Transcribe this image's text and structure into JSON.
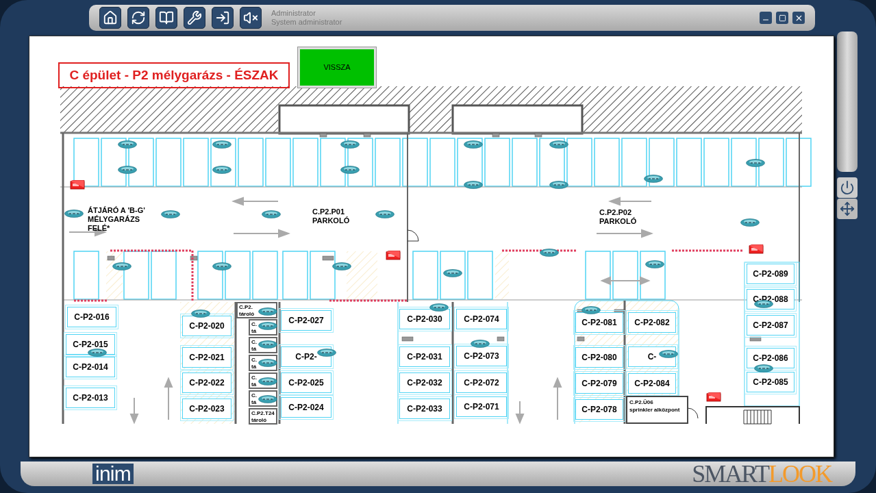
{
  "user": {
    "name": "Administrator",
    "role": "System administrator"
  },
  "map": {
    "title": "C épület - P2 mélygarázs - ÉSZAK",
    "back_button": "VISSZA",
    "areas": [
      {
        "lines": [
          "ÁTJÁRÓ A 'B-G'",
          "MÉLYGARÁZS",
          "FELÉ*"
        ]
      },
      {
        "lines": [
          "C.P2.P01",
          "PARKOLÓ"
        ]
      },
      {
        "lines": [
          "C.P2.P02",
          "PARKOLÓ"
        ]
      }
    ],
    "parking_spaces": [
      {
        "label": "C-P2-016"
      },
      {
        "label": "C-P2-015"
      },
      {
        "label": "C-P2-014"
      },
      {
        "label": "C-P2-013"
      },
      {
        "label": "C-P2-020"
      },
      {
        "label": "C-P2-021"
      },
      {
        "label": "C-P2-022"
      },
      {
        "label": "C-P2-023"
      },
      {
        "label": "C-P2-027"
      },
      {
        "label": "C-P2-"
      },
      {
        "label": "C-P2-025"
      },
      {
        "label": "C-P2-024"
      },
      {
        "label": "C-P2-030"
      },
      {
        "label": "C-P2-031"
      },
      {
        "label": "C-P2-032"
      },
      {
        "label": "C-P2-033"
      },
      {
        "label": "C-P2-074"
      },
      {
        "label": "C-P2-073"
      },
      {
        "label": "C-P2-072"
      },
      {
        "label": "C-P2-071"
      },
      {
        "label": "C-P2-081"
      },
      {
        "label": "C-P2-080"
      },
      {
        "label": "C-P2-079"
      },
      {
        "label": "C-P2-078"
      },
      {
        "label": "C-P2-082"
      },
      {
        "label": "C-"
      },
      {
        "label": "C-P2-084"
      },
      {
        "label": "C-P2-089"
      },
      {
        "label": "C-P2-088"
      },
      {
        "label": "C-P2-087"
      },
      {
        "label": "C-P2-086"
      },
      {
        "label": "C-P2-085"
      }
    ],
    "storage_rooms": [
      {
        "lines": [
          "C.P2.",
          "tároló"
        ]
      },
      {
        "lines": [
          "C.",
          "tá"
        ]
      },
      {
        "lines": [
          "C.",
          "tá"
        ]
      },
      {
        "lines": [
          "C.",
          "tá"
        ]
      },
      {
        "lines": [
          "C.",
          "tá"
        ]
      },
      {
        "lines": [
          "C.",
          "tá"
        ]
      },
      {
        "lines": [
          "C.P2.T24",
          "tároló"
        ]
      }
    ],
    "rooms": [
      {
        "lines": [
          "C.P2.Ü06",
          "sprinkler alközpont"
        ]
      }
    ]
  },
  "footer": {
    "brand": "inim",
    "product": [
      "SMART",
      "LOOK"
    ]
  }
}
